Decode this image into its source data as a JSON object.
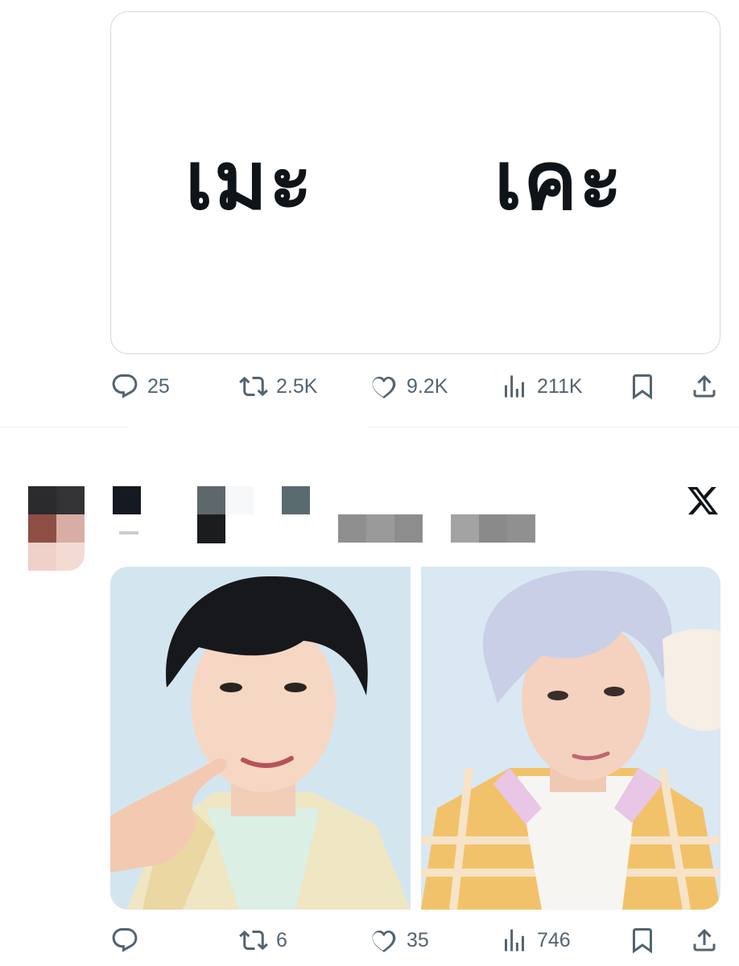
{
  "tweet1": {
    "media_text": [
      "เมะ",
      "เคะ"
    ],
    "actions": {
      "reply": "25",
      "repost": "2.5K",
      "like": "9.2K",
      "views": "211K"
    }
  },
  "tweet2": {
    "header_redacted": true,
    "platform_logo": "x-logo",
    "media": [
      "photo-left",
      "photo-right"
    ],
    "actions": {
      "reply": "",
      "repost": "6",
      "like": "35",
      "views": "746"
    }
  },
  "icons": [
    "reply-icon",
    "repost-icon",
    "like-icon",
    "views-icon",
    "bookmark-icon",
    "share-icon",
    "x-logo-icon"
  ],
  "colors": {
    "text": "#0f1419",
    "muted": "#536471",
    "border": "#cfd9de"
  }
}
